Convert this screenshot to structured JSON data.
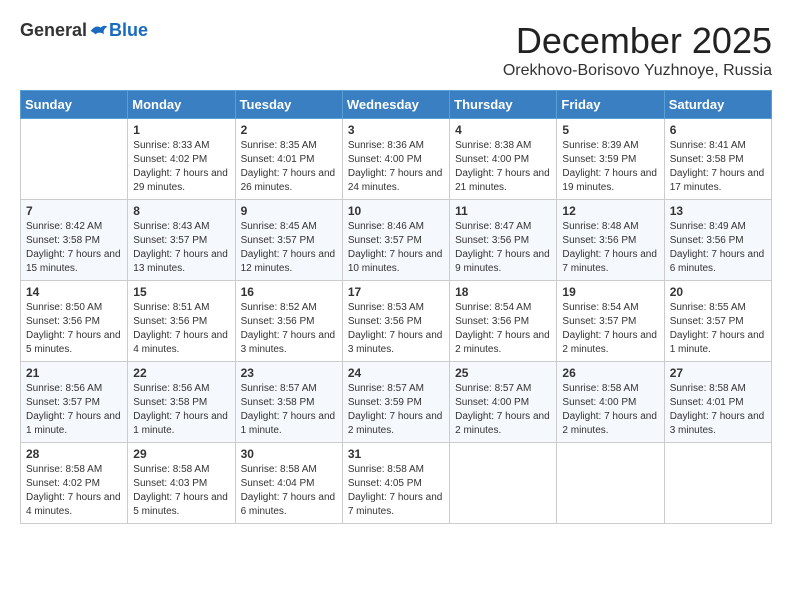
{
  "logo": {
    "general": "General",
    "blue": "Blue"
  },
  "header": {
    "month": "December 2025",
    "location": "Orekhovo-Borisovo Yuzhnoye, Russia"
  },
  "weekdays": [
    "Sunday",
    "Monday",
    "Tuesday",
    "Wednesday",
    "Thursday",
    "Friday",
    "Saturday"
  ],
  "weeks": [
    [
      {
        "day": "",
        "sunrise": "",
        "sunset": "",
        "daylight": ""
      },
      {
        "day": "1",
        "sunrise": "Sunrise: 8:33 AM",
        "sunset": "Sunset: 4:02 PM",
        "daylight": "Daylight: 7 hours and 29 minutes."
      },
      {
        "day": "2",
        "sunrise": "Sunrise: 8:35 AM",
        "sunset": "Sunset: 4:01 PM",
        "daylight": "Daylight: 7 hours and 26 minutes."
      },
      {
        "day": "3",
        "sunrise": "Sunrise: 8:36 AM",
        "sunset": "Sunset: 4:00 PM",
        "daylight": "Daylight: 7 hours and 24 minutes."
      },
      {
        "day": "4",
        "sunrise": "Sunrise: 8:38 AM",
        "sunset": "Sunset: 4:00 PM",
        "daylight": "Daylight: 7 hours and 21 minutes."
      },
      {
        "day": "5",
        "sunrise": "Sunrise: 8:39 AM",
        "sunset": "Sunset: 3:59 PM",
        "daylight": "Daylight: 7 hours and 19 minutes."
      },
      {
        "day": "6",
        "sunrise": "Sunrise: 8:41 AM",
        "sunset": "Sunset: 3:58 PM",
        "daylight": "Daylight: 7 hours and 17 minutes."
      }
    ],
    [
      {
        "day": "7",
        "sunrise": "Sunrise: 8:42 AM",
        "sunset": "Sunset: 3:58 PM",
        "daylight": "Daylight: 7 hours and 15 minutes."
      },
      {
        "day": "8",
        "sunrise": "Sunrise: 8:43 AM",
        "sunset": "Sunset: 3:57 PM",
        "daylight": "Daylight: 7 hours and 13 minutes."
      },
      {
        "day": "9",
        "sunrise": "Sunrise: 8:45 AM",
        "sunset": "Sunset: 3:57 PM",
        "daylight": "Daylight: 7 hours and 12 minutes."
      },
      {
        "day": "10",
        "sunrise": "Sunrise: 8:46 AM",
        "sunset": "Sunset: 3:57 PM",
        "daylight": "Daylight: 7 hours and 10 minutes."
      },
      {
        "day": "11",
        "sunrise": "Sunrise: 8:47 AM",
        "sunset": "Sunset: 3:56 PM",
        "daylight": "Daylight: 7 hours and 9 minutes."
      },
      {
        "day": "12",
        "sunrise": "Sunrise: 8:48 AM",
        "sunset": "Sunset: 3:56 PM",
        "daylight": "Daylight: 7 hours and 7 minutes."
      },
      {
        "day": "13",
        "sunrise": "Sunrise: 8:49 AM",
        "sunset": "Sunset: 3:56 PM",
        "daylight": "Daylight: 7 hours and 6 minutes."
      }
    ],
    [
      {
        "day": "14",
        "sunrise": "Sunrise: 8:50 AM",
        "sunset": "Sunset: 3:56 PM",
        "daylight": "Daylight: 7 hours and 5 minutes."
      },
      {
        "day": "15",
        "sunrise": "Sunrise: 8:51 AM",
        "sunset": "Sunset: 3:56 PM",
        "daylight": "Daylight: 7 hours and 4 minutes."
      },
      {
        "day": "16",
        "sunrise": "Sunrise: 8:52 AM",
        "sunset": "Sunset: 3:56 PM",
        "daylight": "Daylight: 7 hours and 3 minutes."
      },
      {
        "day": "17",
        "sunrise": "Sunrise: 8:53 AM",
        "sunset": "Sunset: 3:56 PM",
        "daylight": "Daylight: 7 hours and 3 minutes."
      },
      {
        "day": "18",
        "sunrise": "Sunrise: 8:54 AM",
        "sunset": "Sunset: 3:56 PM",
        "daylight": "Daylight: 7 hours and 2 minutes."
      },
      {
        "day": "19",
        "sunrise": "Sunrise: 8:54 AM",
        "sunset": "Sunset: 3:57 PM",
        "daylight": "Daylight: 7 hours and 2 minutes."
      },
      {
        "day": "20",
        "sunrise": "Sunrise: 8:55 AM",
        "sunset": "Sunset: 3:57 PM",
        "daylight": "Daylight: 7 hours and 1 minute."
      }
    ],
    [
      {
        "day": "21",
        "sunrise": "Sunrise: 8:56 AM",
        "sunset": "Sunset: 3:57 PM",
        "daylight": "Daylight: 7 hours and 1 minute."
      },
      {
        "day": "22",
        "sunrise": "Sunrise: 8:56 AM",
        "sunset": "Sunset: 3:58 PM",
        "daylight": "Daylight: 7 hours and 1 minute."
      },
      {
        "day": "23",
        "sunrise": "Sunrise: 8:57 AM",
        "sunset": "Sunset: 3:58 PM",
        "daylight": "Daylight: 7 hours and 1 minute."
      },
      {
        "day": "24",
        "sunrise": "Sunrise: 8:57 AM",
        "sunset": "Sunset: 3:59 PM",
        "daylight": "Daylight: 7 hours and 2 minutes."
      },
      {
        "day": "25",
        "sunrise": "Sunrise: 8:57 AM",
        "sunset": "Sunset: 4:00 PM",
        "daylight": "Daylight: 7 hours and 2 minutes."
      },
      {
        "day": "26",
        "sunrise": "Sunrise: 8:58 AM",
        "sunset": "Sunset: 4:00 PM",
        "daylight": "Daylight: 7 hours and 2 minutes."
      },
      {
        "day": "27",
        "sunrise": "Sunrise: 8:58 AM",
        "sunset": "Sunset: 4:01 PM",
        "daylight": "Daylight: 7 hours and 3 minutes."
      }
    ],
    [
      {
        "day": "28",
        "sunrise": "Sunrise: 8:58 AM",
        "sunset": "Sunset: 4:02 PM",
        "daylight": "Daylight: 7 hours and 4 minutes."
      },
      {
        "day": "29",
        "sunrise": "Sunrise: 8:58 AM",
        "sunset": "Sunset: 4:03 PM",
        "daylight": "Daylight: 7 hours and 5 minutes."
      },
      {
        "day": "30",
        "sunrise": "Sunrise: 8:58 AM",
        "sunset": "Sunset: 4:04 PM",
        "daylight": "Daylight: 7 hours and 6 minutes."
      },
      {
        "day": "31",
        "sunrise": "Sunrise: 8:58 AM",
        "sunset": "Sunset: 4:05 PM",
        "daylight": "Daylight: 7 hours and 7 minutes."
      },
      {
        "day": "",
        "sunrise": "",
        "sunset": "",
        "daylight": ""
      },
      {
        "day": "",
        "sunrise": "",
        "sunset": "",
        "daylight": ""
      },
      {
        "day": "",
        "sunrise": "",
        "sunset": "",
        "daylight": ""
      }
    ]
  ]
}
